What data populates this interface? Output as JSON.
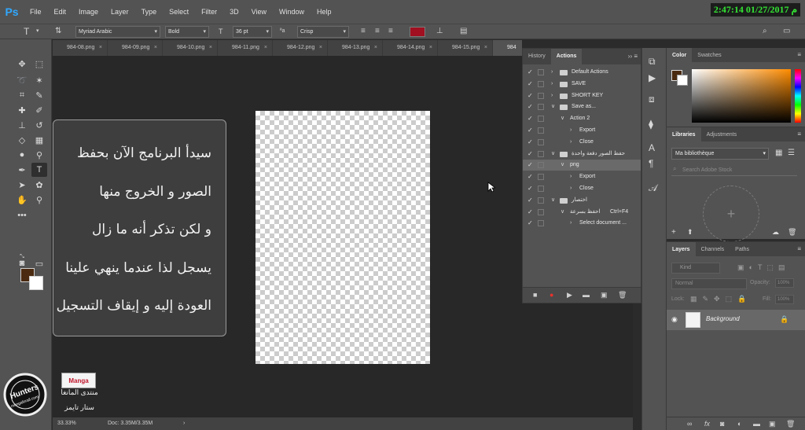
{
  "app": {
    "logo": "Ps"
  },
  "menu": [
    "File",
    "Edit",
    "Image",
    "Layer",
    "Type",
    "Select",
    "Filter",
    "3D",
    "View",
    "Window",
    "Help"
  ],
  "clock": "2:47:14 01/27/2017 م",
  "options": {
    "font_family": "Myriad Arabic",
    "font_style": "Bold",
    "font_size": "36 pt",
    "antialias": "Crisp",
    "text_color": "#a01020"
  },
  "tools": {
    "foreground_color": "#4a2a10",
    "background_color": "#ffffff",
    "active_tool": "type-tool"
  },
  "doc_tabs": [
    "984-08.png",
    "984-09.png",
    "984-10.png",
    "984-11.png",
    "984-12.png",
    "984-13.png",
    "984-14.png",
    "984-15.png",
    "984"
  ],
  "note": {
    "lines": [
      "سيدأ البرنامج الآن بحفظ",
      "الصور و الخروج منها",
      "و لكن تذكر أنه ما زال",
      "يسجل لذا عندما ينهي علينا",
      "العودة إليه و إيقاف التسجيل"
    ]
  },
  "watermark": {
    "badge": "Manga",
    "line1": "منتدى المانغا",
    "line2": "ستار تايمز",
    "logo_text": "Hunters",
    "logo_subtext": "mangaforall.com"
  },
  "status": {
    "zoom": "33.33%",
    "doc": "Doc: 3.35M/3.35M"
  },
  "actions_panel": {
    "tabs": [
      "History",
      "Actions"
    ],
    "active_tab": "Actions",
    "rows": [
      {
        "label": "Default Actions",
        "level": 0,
        "folder": true,
        "expanded": false,
        "key": ""
      },
      {
        "label": "SAVE",
        "level": 0,
        "folder": true,
        "expanded": false,
        "key": ""
      },
      {
        "label": "SHORT KEY",
        "level": 0,
        "folder": true,
        "expanded": false,
        "key": ""
      },
      {
        "label": "Save as...",
        "level": 0,
        "folder": true,
        "expanded": true,
        "key": ""
      },
      {
        "label": "Action 2",
        "level": 1,
        "folder": false,
        "expanded": true,
        "key": ""
      },
      {
        "label": "Export",
        "level": 2,
        "folder": false,
        "expanded": false,
        "key": ""
      },
      {
        "label": "Close",
        "level": 2,
        "folder": false,
        "expanded": false,
        "key": ""
      },
      {
        "label": "حفظ الصور دفعة واحدة",
        "level": 0,
        "folder": true,
        "expanded": true,
        "key": ""
      },
      {
        "label": "png",
        "level": 1,
        "folder": false,
        "expanded": true,
        "key": "",
        "selected": true
      },
      {
        "label": "Export",
        "level": 2,
        "folder": false,
        "expanded": false,
        "key": ""
      },
      {
        "label": "Close",
        "level": 2,
        "folder": false,
        "expanded": false,
        "key": ""
      },
      {
        "label": "اختصار",
        "level": 0,
        "folder": true,
        "expanded": true,
        "key": ""
      },
      {
        "label": "احفظ بسرعة",
        "level": 1,
        "folder": false,
        "expanded": true,
        "key": "Ctrl+F4"
      },
      {
        "label": "Select document ...",
        "level": 2,
        "folder": false,
        "expanded": false,
        "key": ""
      }
    ]
  },
  "color_panel": {
    "tabs": [
      "Color",
      "Swatches"
    ],
    "active_tab": "Color",
    "fg": "#4a2a10",
    "bg": "#ffffff"
  },
  "libraries_panel": {
    "tabs": [
      "Libraries",
      "Adjustments"
    ],
    "active_tab": "Libraries",
    "library": "Ma bibliothèque",
    "search_placeholder": "Search Adobe Stock",
    "add_symbol": "+"
  },
  "layers_panel": {
    "tabs": [
      "Layers",
      "Channels",
      "Paths"
    ],
    "active_tab": "Layers",
    "kind": "Kind",
    "blend_mode": "Normal",
    "opacity_label": "Opacity:",
    "opacity_value": "100%",
    "lock_label": "Lock:",
    "fill_label": "Fill:",
    "fill_value": "100%",
    "layers": [
      {
        "name": "Background"
      }
    ]
  }
}
